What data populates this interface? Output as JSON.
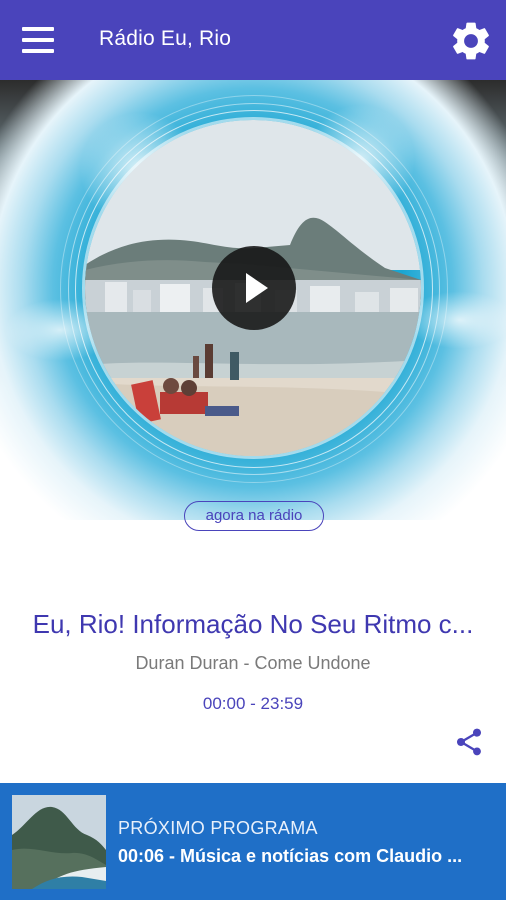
{
  "app": {
    "title": "Rádio Eu, Rio",
    "accent": "#4a44bb",
    "next_bar_color": "#1f6fc7"
  },
  "header": {
    "menu_icon": "hamburger-icon",
    "settings_icon": "gear-icon"
  },
  "player": {
    "cover_image": "Copacabana beach with Sugarloaf mountain",
    "play_icon": "play-icon",
    "now_label": "agora na rádio",
    "program_title": "Eu, Rio! Informação No Seu Ritmo c...",
    "song": "Duran Duran - Come Undone",
    "hours": "00:00 - 23:59",
    "share_icon": "share-icon"
  },
  "next": {
    "label": "PRÓXIMO PROGRAMA",
    "title": "00:06 - Música e notícias com Claudio ...",
    "thumbnail": "Rio coastline with mountain"
  }
}
